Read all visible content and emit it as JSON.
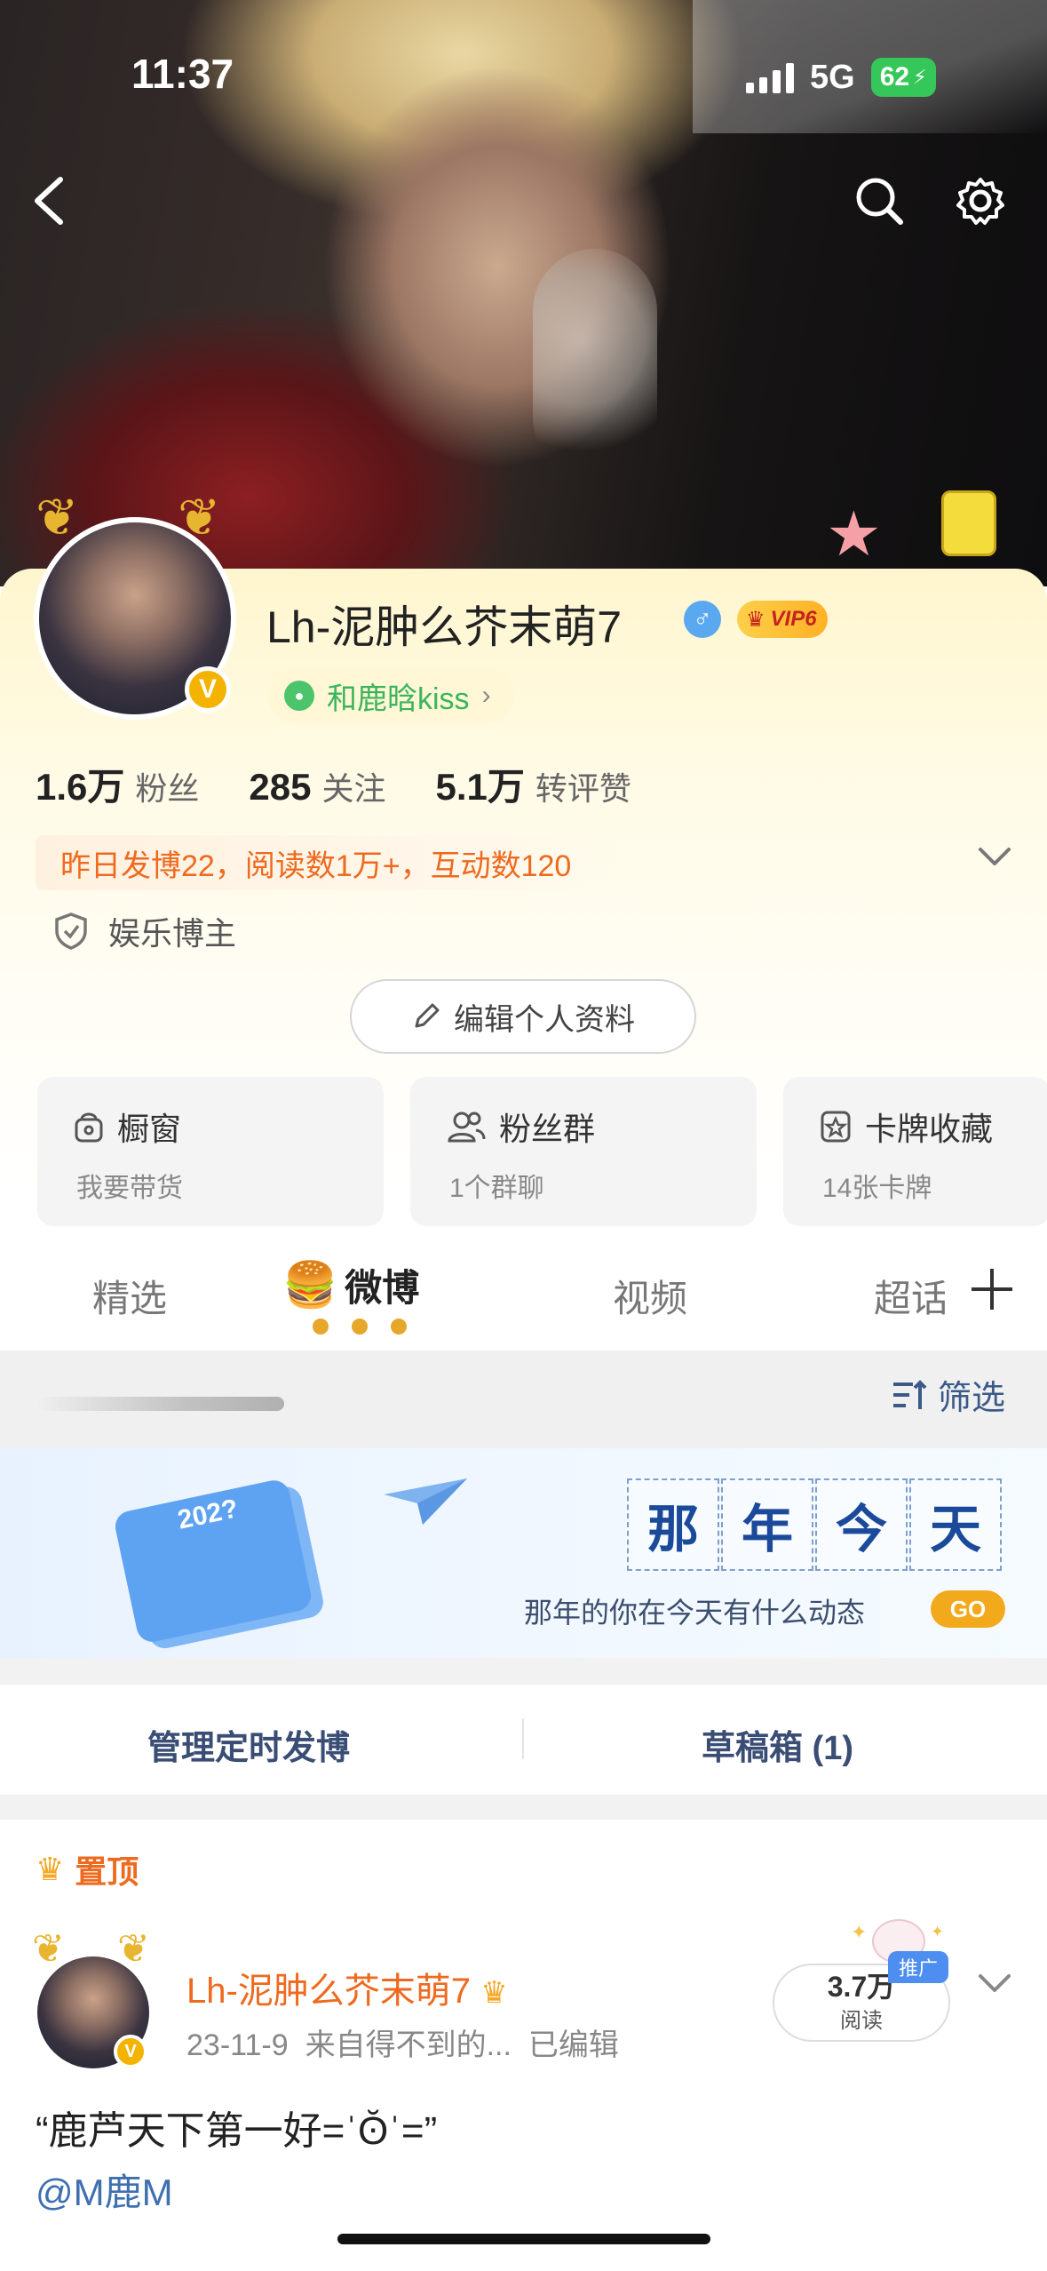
{
  "status_bar": {
    "time": "11:37",
    "network": "5G",
    "battery": "62"
  },
  "profile": {
    "name": "Lh-泥肿么芥末萌7",
    "gender_symbol": "♂",
    "vip_label": "VIP6",
    "tag_label": "和鹿晗kiss",
    "stats": [
      {
        "value": "1.6万",
        "label": "粉丝"
      },
      {
        "value": "285",
        "label": "关注"
      },
      {
        "value": "5.1万",
        "label": "转评赞"
      }
    ],
    "yesterday_summary": "昨日发博22，阅读数1万+，互动数120",
    "creator_label": "娱乐博主",
    "edit_button": "编辑个人资料"
  },
  "cards": [
    {
      "title": "橱窗",
      "subtitle": "我要带货",
      "icon": "shop-bag-icon"
    },
    {
      "title": "粉丝群",
      "subtitle": "1个群聊",
      "icon": "group-icon"
    },
    {
      "title": "卡牌收藏",
      "subtitle": "14张卡牌",
      "icon": "card-star-icon"
    }
  ],
  "tabs": [
    {
      "label": "精选",
      "active": false
    },
    {
      "label": "微博",
      "active": true
    },
    {
      "label": "视频",
      "active": false
    },
    {
      "label": "超话",
      "active": false
    }
  ],
  "filter_label": "筛选",
  "banner": {
    "year": "202?",
    "title_chars": [
      "那",
      "年",
      "今",
      "天"
    ],
    "subtitle": "那年的你在今天有什么动态",
    "go": "GO"
  },
  "manage": {
    "scheduled": "管理定时发博",
    "drafts": "草稿箱 (1)"
  },
  "post": {
    "pinned_label": "置顶",
    "author": "Lh-泥肿么芥末萌7",
    "date": "23-11-9",
    "source": "来自得不到的...",
    "edited": "已编辑",
    "views_count": "3.7万",
    "views_label": "阅读",
    "promo_label": "推广",
    "text": "“鹿芦天下第一好=ˈʘ̆ˈ=”",
    "mention": "@M鹿M"
  },
  "colors": {
    "accent_orange": "#ee6a1f",
    "link_blue": "#3e6fb0",
    "vip_gold": "#ffb125",
    "tag_green": "#3bb55c",
    "battery_green": "#35c759"
  }
}
